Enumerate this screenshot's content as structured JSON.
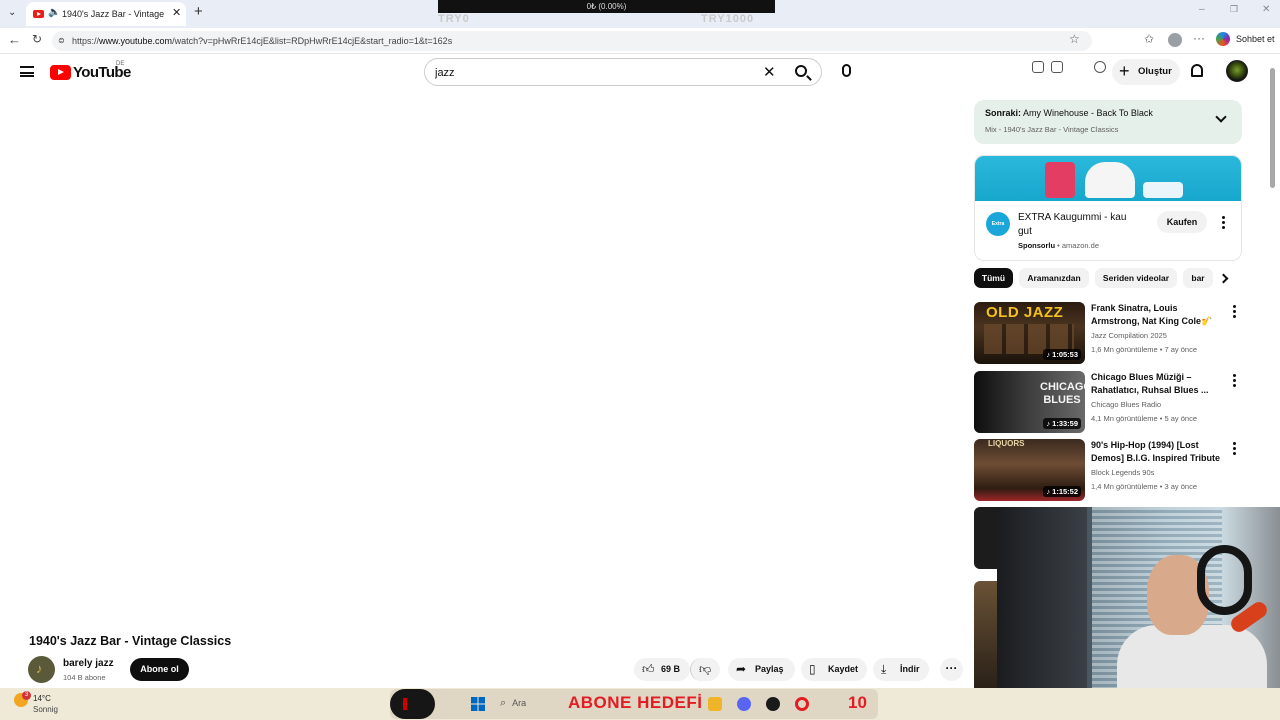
{
  "browser": {
    "tab_title": "1940's Jazz Bar - Vintage Classics",
    "url_prefix": "https://",
    "url_host": "www.youtube.com",
    "url_path": "/watch?v=pHwRrE14cjE&list=RDpHwRrE14cjE&start_radio=1&t=162s",
    "copilot_label": "Sohbet et",
    "ticker": {
      "top_text": "0₺ (0.00%)",
      "left_label": "TRY0",
      "right_label": "TRY1000"
    }
  },
  "header": {
    "logo_text": "YouTube",
    "country_code": "DE",
    "search_value": "jazz",
    "create_label": "Oluştur"
  },
  "video": {
    "title": "1940's Jazz Bar - Vintage Classics",
    "channel_name": "barely jazz",
    "channel_subs": "104 B abone",
    "subscribe_label": "Abone ol",
    "actions": {
      "likes": "69 B",
      "share": "Paylaş",
      "save": "Kaydet",
      "download": "İndir"
    }
  },
  "sidebar": {
    "up_next_prefix": "Sonraki:",
    "up_next_title": "Amy Winehouse - Back To Black",
    "up_next_mix": "Mix - 1940's Jazz Bar - Vintage Classics",
    "ad": {
      "title": "EXTRA Kaugummi - kau gut",
      "sponsored": "Sponsorlu",
      "domain": "amazon.de",
      "button": "Kaufen",
      "logo_text": "Extra"
    },
    "chips": [
      "Tümü",
      "Aramanızdan",
      "Seriden videolar",
      "bar"
    ],
    "recommendations": [
      {
        "title": "Frank Sinatra, Louis Armstrong, Nat King Cole🎷 The Ultimate ...",
        "channel": "Jazz Compilation 2025",
        "meta": "1,6 Mn görüntüleme • 7 ay önce",
        "duration": "♪ 1:05:53",
        "thumb_text": "OLD JAZZ"
      },
      {
        "title": "Chicago Blues Müziği – Rahatlatıcı, Ruhsal Blues ...",
        "channel": "Chicago Blues Radio",
        "meta": "4,1 Mn görüntüleme • 5 ay önce",
        "duration": "♪ 1:33:59",
        "thumb_text": "CHICAGO BLUES"
      },
      {
        "title": "90's Hip-Hop (1994) [Lost Demos] B.I.G. Inspired Tribute ...",
        "channel": "Block Legends 90s",
        "meta": "1,4 Mn görüntüleme • 3 ay önce",
        "duration": "♪ 1:15:52",
        "thumb_text": "LIQUORS"
      }
    ]
  },
  "taskbar": {
    "temperature": "14°C",
    "weather": "Sonnig",
    "weather_badge": "3",
    "search_label": "Ara",
    "banner_text": "ABONE HEDEFİ",
    "banner_count": "10"
  }
}
